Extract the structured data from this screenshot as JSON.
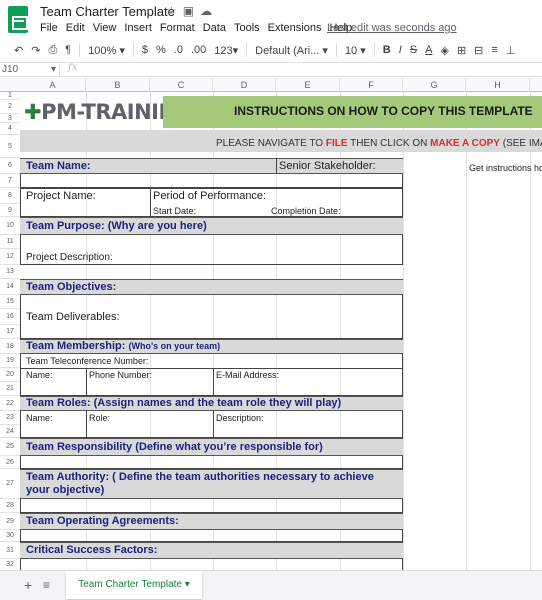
{
  "app": {
    "doc_title": "Team Charter Template",
    "last_edit": "Last edit was seconds ago",
    "menu": [
      "File",
      "Edit",
      "View",
      "Insert",
      "Format",
      "Data",
      "Tools",
      "Extensions",
      "Help"
    ]
  },
  "toolbar": {
    "zoom": "100%",
    "currency": "$",
    "percent": "%",
    "dec_decrease": ".0",
    "dec_increase": ".00",
    "more_formats": "123",
    "font": "Default (Ari...",
    "font_size": "10"
  },
  "formula_bar": {
    "cell_ref": "J10",
    "fx": "fx"
  },
  "columns": [
    "A",
    "B",
    "C",
    "D",
    "E",
    "F",
    "G",
    "H"
  ],
  "rows": [
    "1",
    "2",
    "3",
    "4",
    "5",
    "6",
    "7",
    "8",
    "9",
    "10",
    "11",
    "12",
    "13",
    "14",
    "15",
    "16",
    "17",
    "18",
    "19",
    "20",
    "21",
    "22",
    "23",
    "24",
    "25",
    "26",
    "27",
    "28",
    "29",
    "30",
    "31",
    "32"
  ],
  "sheet": {
    "logo_text": "PM-TRAINING",
    "banner_title": "INSTRUCTIONS ON HOW TO COPY THIS TEMPLATE",
    "instr_prefix": "PLEASE NAVIGATE TO",
    "instr_file": "FILE",
    "instr_mid": "THEN CLICK ON",
    "instr_copy": "MAKE A COPY",
    "instr_suffix": "(SEE IMAGE)",
    "side_note": "Get instructions how",
    "team_name": "Team Name:",
    "senior_stakeholder": "Senior Stakeholder:",
    "project_name": "Project Name:",
    "period": "Period of Performance:",
    "start_date": "Start Date:",
    "completion_date": "Completion Date:",
    "team_purpose": "Team Purpose: (Why are you here)",
    "project_description": "Project Description:",
    "team_objectives": "Team Objectives:",
    "team_deliverables": "Team Deliverables:",
    "team_membership": "Team Membership:",
    "team_membership_sub": "(Who's on your team)",
    "teleconference": "Team Teleconference Number:",
    "name": "Name:",
    "phone": "Phone Number:",
    "email": "E-Mail Address:",
    "team_roles": "Team Roles: (Assign names and the team role they will play)",
    "roles_name": "Name:",
    "roles_role": "Role:",
    "roles_description": "Description:",
    "team_responsibility": "Team Responsibility (Define what you’re responsible for)",
    "team_authority": "Team Authority: ( Define the team authorities necessary to achieve your objective)",
    "operating_agreements": "Team Operating Agreements:",
    "critical_success": "Critical Success Factors:"
  },
  "sheet_tab": {
    "name": "Team Charter Template"
  }
}
